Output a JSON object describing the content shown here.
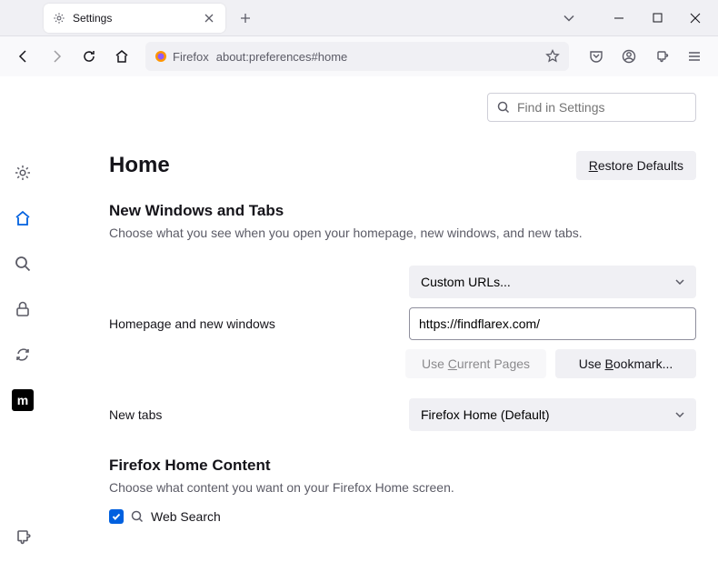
{
  "tab": {
    "title": "Settings"
  },
  "urlbar": {
    "identity": "Firefox",
    "url": "about:preferences#home"
  },
  "search": {
    "placeholder": "Find in Settings"
  },
  "page": {
    "title": "Home",
    "restore": "Restore Defaults",
    "section1": {
      "heading": "New Windows and Tabs",
      "desc": "Choose what you see when you open your homepage, new windows, and new tabs."
    },
    "homepage": {
      "label": "Homepage and new windows",
      "select": "Custom URLs...",
      "value": "https://findflarex.com/",
      "use_current": "Use Current Pages",
      "use_bookmark": "Use Bookmark..."
    },
    "newtabs": {
      "label": "New tabs",
      "select": "Firefox Home (Default)"
    },
    "section2": {
      "heading": "Firefox Home Content",
      "desc": "Choose what content you want on your Firefox Home screen.",
      "web_search": "Web Search"
    }
  }
}
